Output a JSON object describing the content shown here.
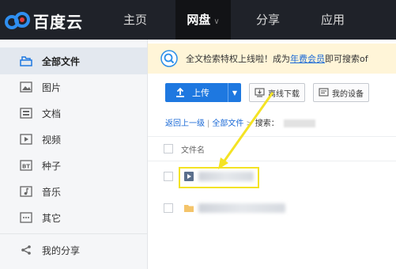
{
  "app": {
    "logo_text": "百度云"
  },
  "nav": {
    "items": [
      {
        "label": "主页"
      },
      {
        "label": "网盘"
      },
      {
        "label": "分享"
      },
      {
        "label": "应用"
      }
    ]
  },
  "sidebar": {
    "items": [
      {
        "label": "全部文件",
        "icon": "folder-icon"
      },
      {
        "label": "图片",
        "icon": "image-icon"
      },
      {
        "label": "文档",
        "icon": "document-icon"
      },
      {
        "label": "视频",
        "icon": "video-icon"
      },
      {
        "label": "种子",
        "icon": "bt-icon"
      },
      {
        "label": "音乐",
        "icon": "music-icon"
      },
      {
        "label": "其它",
        "icon": "more-icon"
      },
      {
        "label": "我的分享",
        "icon": "share-icon"
      }
    ]
  },
  "notice": {
    "text_before": "全文检索特权上线啦！成为",
    "link": "年费会员",
    "text_after": "即可搜索of"
  },
  "toolbar": {
    "upload_label": "上传",
    "offline_label": "离线下载",
    "device_label": "我的设备"
  },
  "breadcrumb": {
    "back": "返回上一级",
    "all": "全部文件",
    "search_label": "搜索："
  },
  "file_list": {
    "column_name": "文件名"
  },
  "colors": {
    "accent": "#1e78e0",
    "topbar": "#1f2229",
    "highlight": "#f4e324"
  }
}
